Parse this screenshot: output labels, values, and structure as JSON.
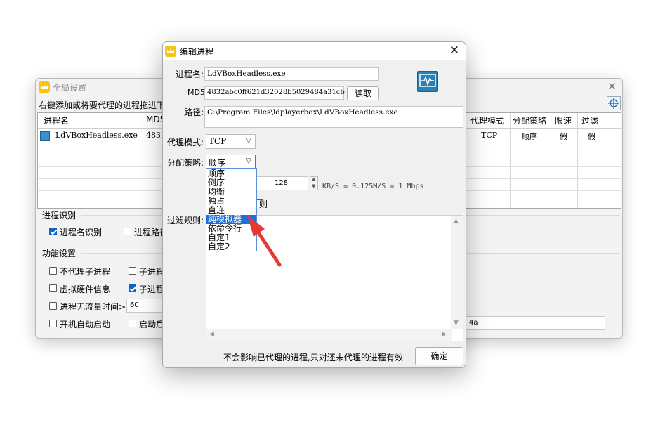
{
  "bg_window": {
    "title": "全局设置",
    "hint": "右键添加或将要代理的进程拖进下",
    "table": {
      "headers_left": [
        "进程名",
        "MD5"
      ],
      "headers_right": [
        "代理模式",
        "分配策略",
        "限速",
        "过滤"
      ],
      "row": {
        "name": "LdVBoxHeadless.exe",
        "md5": "4832",
        "mode": "TCP",
        "policy": "顺序",
        "limit": "假",
        "filter": "假"
      }
    },
    "section_identify": "进程识别",
    "identify_by_name": "进程名识别",
    "identify_by_path": "进程路径",
    "section_function": "功能设置",
    "no_child_proxy": "不代理子进程",
    "child_proc_1": "子进程",
    "virtual_hw": "虚拟硬件信息",
    "child_proc_2": "子进程",
    "no_traffic_time": "进程无流量时间>",
    "no_traffic_value": "60",
    "autostart": "开机自动启动",
    "start_after": "启动后",
    "right_field_value": "4a"
  },
  "dialog": {
    "title": "编辑进程",
    "process_name_label": "进程名:",
    "process_name": "LdVBoxHeadless.exe",
    "md5_label": "MD5:",
    "md5": "4832abc0ff621d32028b5029484a31cb",
    "read_button": "读取",
    "path_label": "路径:",
    "path": "C:\\Program Files\\ldplayerbox\\LdVBoxHeadless.exe",
    "proxy_mode_label": "代理模式:",
    "proxy_mode": "TCP",
    "policy_label": "分配策略:",
    "policy": "顺序",
    "policy_options": [
      "顺序",
      "倒序",
      "均衡",
      "独占",
      "直连",
      "纯模拟器",
      "依命令行",
      "自定1",
      "自定2"
    ],
    "selected_option_index": 5,
    "speed_value": "128",
    "speed_unit": "KB/S = 0.125M/S = 1 Mbps",
    "partial_label": "则",
    "filter_label": "过滤规则:",
    "footer_note": "不会影响已代理的进程,只对还未代理的进程有效",
    "confirm_button": "确定"
  },
  "colors": {
    "selection": "#1e6fd9",
    "checkbox_checked": "#0b63cc",
    "annotation_arrow": "#e53935",
    "app_icon": "#f5c518"
  },
  "icons": {
    "app": "crown-icon",
    "close": "close-icon",
    "locator": "crosshair-icon",
    "monitor": "pulse-monitor-icon"
  }
}
